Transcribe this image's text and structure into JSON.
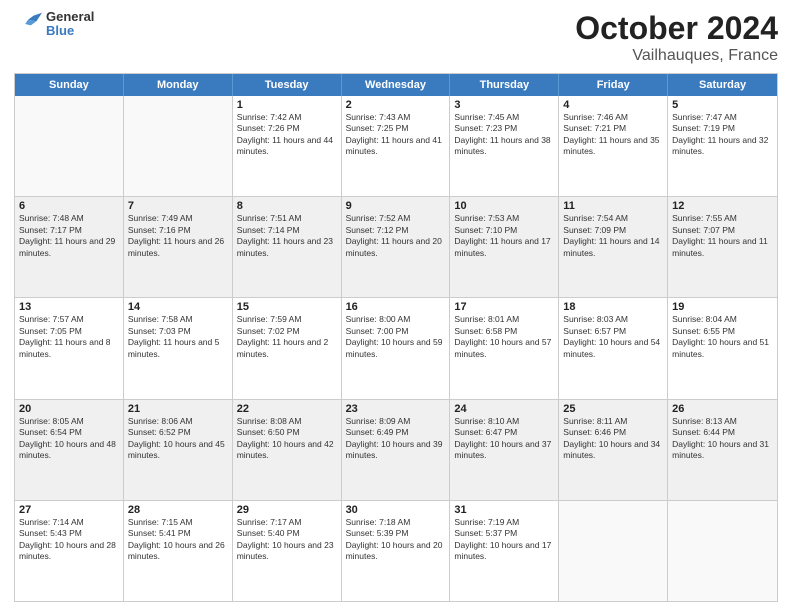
{
  "header": {
    "logo": {
      "general": "General",
      "blue": "Blue"
    },
    "title": "October 2024",
    "subtitle": "Vailhauques, France"
  },
  "weekdays": [
    "Sunday",
    "Monday",
    "Tuesday",
    "Wednesday",
    "Thursday",
    "Friday",
    "Saturday"
  ],
  "weeks": [
    [
      {
        "day": "",
        "sunrise": "",
        "sunset": "",
        "daylight": "",
        "shaded": false,
        "empty": true
      },
      {
        "day": "",
        "sunrise": "",
        "sunset": "",
        "daylight": "",
        "shaded": false,
        "empty": true
      },
      {
        "day": "1",
        "sunrise": "Sunrise: 7:42 AM",
        "sunset": "Sunset: 7:26 PM",
        "daylight": "Daylight: 11 hours and 44 minutes.",
        "shaded": false,
        "empty": false
      },
      {
        "day": "2",
        "sunrise": "Sunrise: 7:43 AM",
        "sunset": "Sunset: 7:25 PM",
        "daylight": "Daylight: 11 hours and 41 minutes.",
        "shaded": false,
        "empty": false
      },
      {
        "day": "3",
        "sunrise": "Sunrise: 7:45 AM",
        "sunset": "Sunset: 7:23 PM",
        "daylight": "Daylight: 11 hours and 38 minutes.",
        "shaded": false,
        "empty": false
      },
      {
        "day": "4",
        "sunrise": "Sunrise: 7:46 AM",
        "sunset": "Sunset: 7:21 PM",
        "daylight": "Daylight: 11 hours and 35 minutes.",
        "shaded": false,
        "empty": false
      },
      {
        "day": "5",
        "sunrise": "Sunrise: 7:47 AM",
        "sunset": "Sunset: 7:19 PM",
        "daylight": "Daylight: 11 hours and 32 minutes.",
        "shaded": false,
        "empty": false
      }
    ],
    [
      {
        "day": "6",
        "sunrise": "Sunrise: 7:48 AM",
        "sunset": "Sunset: 7:17 PM",
        "daylight": "Daylight: 11 hours and 29 minutes.",
        "shaded": true,
        "empty": false
      },
      {
        "day": "7",
        "sunrise": "Sunrise: 7:49 AM",
        "sunset": "Sunset: 7:16 PM",
        "daylight": "Daylight: 11 hours and 26 minutes.",
        "shaded": true,
        "empty": false
      },
      {
        "day": "8",
        "sunrise": "Sunrise: 7:51 AM",
        "sunset": "Sunset: 7:14 PM",
        "daylight": "Daylight: 11 hours and 23 minutes.",
        "shaded": true,
        "empty": false
      },
      {
        "day": "9",
        "sunrise": "Sunrise: 7:52 AM",
        "sunset": "Sunset: 7:12 PM",
        "daylight": "Daylight: 11 hours and 20 minutes.",
        "shaded": true,
        "empty": false
      },
      {
        "day": "10",
        "sunrise": "Sunrise: 7:53 AM",
        "sunset": "Sunset: 7:10 PM",
        "daylight": "Daylight: 11 hours and 17 minutes.",
        "shaded": true,
        "empty": false
      },
      {
        "day": "11",
        "sunrise": "Sunrise: 7:54 AM",
        "sunset": "Sunset: 7:09 PM",
        "daylight": "Daylight: 11 hours and 14 minutes.",
        "shaded": true,
        "empty": false
      },
      {
        "day": "12",
        "sunrise": "Sunrise: 7:55 AM",
        "sunset": "Sunset: 7:07 PM",
        "daylight": "Daylight: 11 hours and 11 minutes.",
        "shaded": true,
        "empty": false
      }
    ],
    [
      {
        "day": "13",
        "sunrise": "Sunrise: 7:57 AM",
        "sunset": "Sunset: 7:05 PM",
        "daylight": "Daylight: 11 hours and 8 minutes.",
        "shaded": false,
        "empty": false
      },
      {
        "day": "14",
        "sunrise": "Sunrise: 7:58 AM",
        "sunset": "Sunset: 7:03 PM",
        "daylight": "Daylight: 11 hours and 5 minutes.",
        "shaded": false,
        "empty": false
      },
      {
        "day": "15",
        "sunrise": "Sunrise: 7:59 AM",
        "sunset": "Sunset: 7:02 PM",
        "daylight": "Daylight: 11 hours and 2 minutes.",
        "shaded": false,
        "empty": false
      },
      {
        "day": "16",
        "sunrise": "Sunrise: 8:00 AM",
        "sunset": "Sunset: 7:00 PM",
        "daylight": "Daylight: 10 hours and 59 minutes.",
        "shaded": false,
        "empty": false
      },
      {
        "day": "17",
        "sunrise": "Sunrise: 8:01 AM",
        "sunset": "Sunset: 6:58 PM",
        "daylight": "Daylight: 10 hours and 57 minutes.",
        "shaded": false,
        "empty": false
      },
      {
        "day": "18",
        "sunrise": "Sunrise: 8:03 AM",
        "sunset": "Sunset: 6:57 PM",
        "daylight": "Daylight: 10 hours and 54 minutes.",
        "shaded": false,
        "empty": false
      },
      {
        "day": "19",
        "sunrise": "Sunrise: 8:04 AM",
        "sunset": "Sunset: 6:55 PM",
        "daylight": "Daylight: 10 hours and 51 minutes.",
        "shaded": false,
        "empty": false
      }
    ],
    [
      {
        "day": "20",
        "sunrise": "Sunrise: 8:05 AM",
        "sunset": "Sunset: 6:54 PM",
        "daylight": "Daylight: 10 hours and 48 minutes.",
        "shaded": true,
        "empty": false
      },
      {
        "day": "21",
        "sunrise": "Sunrise: 8:06 AM",
        "sunset": "Sunset: 6:52 PM",
        "daylight": "Daylight: 10 hours and 45 minutes.",
        "shaded": true,
        "empty": false
      },
      {
        "day": "22",
        "sunrise": "Sunrise: 8:08 AM",
        "sunset": "Sunset: 6:50 PM",
        "daylight": "Daylight: 10 hours and 42 minutes.",
        "shaded": true,
        "empty": false
      },
      {
        "day": "23",
        "sunrise": "Sunrise: 8:09 AM",
        "sunset": "Sunset: 6:49 PM",
        "daylight": "Daylight: 10 hours and 39 minutes.",
        "shaded": true,
        "empty": false
      },
      {
        "day": "24",
        "sunrise": "Sunrise: 8:10 AM",
        "sunset": "Sunset: 6:47 PM",
        "daylight": "Daylight: 10 hours and 37 minutes.",
        "shaded": true,
        "empty": false
      },
      {
        "day": "25",
        "sunrise": "Sunrise: 8:11 AM",
        "sunset": "Sunset: 6:46 PM",
        "daylight": "Daylight: 10 hours and 34 minutes.",
        "shaded": true,
        "empty": false
      },
      {
        "day": "26",
        "sunrise": "Sunrise: 8:13 AM",
        "sunset": "Sunset: 6:44 PM",
        "daylight": "Daylight: 10 hours and 31 minutes.",
        "shaded": true,
        "empty": false
      }
    ],
    [
      {
        "day": "27",
        "sunrise": "Sunrise: 7:14 AM",
        "sunset": "Sunset: 5:43 PM",
        "daylight": "Daylight: 10 hours and 28 minutes.",
        "shaded": false,
        "empty": false
      },
      {
        "day": "28",
        "sunrise": "Sunrise: 7:15 AM",
        "sunset": "Sunset: 5:41 PM",
        "daylight": "Daylight: 10 hours and 26 minutes.",
        "shaded": false,
        "empty": false
      },
      {
        "day": "29",
        "sunrise": "Sunrise: 7:17 AM",
        "sunset": "Sunset: 5:40 PM",
        "daylight": "Daylight: 10 hours and 23 minutes.",
        "shaded": false,
        "empty": false
      },
      {
        "day": "30",
        "sunrise": "Sunrise: 7:18 AM",
        "sunset": "Sunset: 5:39 PM",
        "daylight": "Daylight: 10 hours and 20 minutes.",
        "shaded": false,
        "empty": false
      },
      {
        "day": "31",
        "sunrise": "Sunrise: 7:19 AM",
        "sunset": "Sunset: 5:37 PM",
        "daylight": "Daylight: 10 hours and 17 minutes.",
        "shaded": false,
        "empty": false
      },
      {
        "day": "",
        "sunrise": "",
        "sunset": "",
        "daylight": "",
        "shaded": false,
        "empty": true
      },
      {
        "day": "",
        "sunrise": "",
        "sunset": "",
        "daylight": "",
        "shaded": false,
        "empty": true
      }
    ]
  ]
}
